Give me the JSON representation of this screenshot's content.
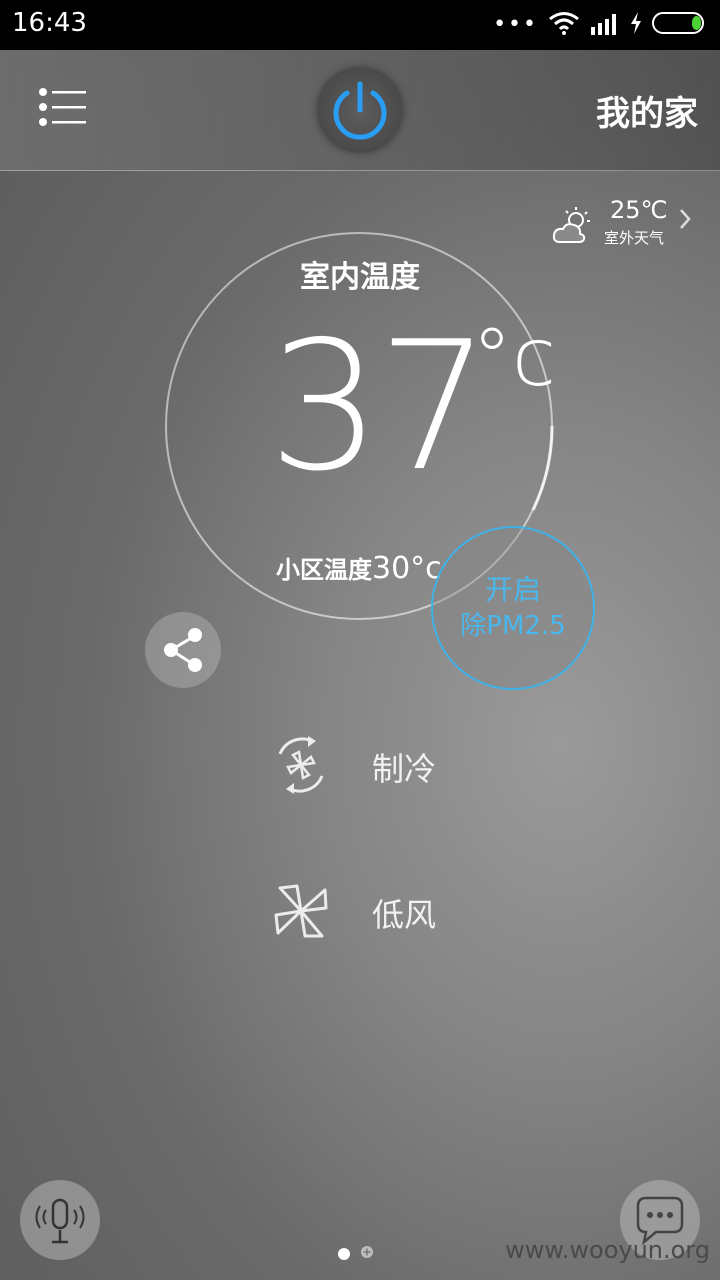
{
  "status_bar": {
    "time": "16:43",
    "dots": "•••",
    "battery_color": "#4cd137"
  },
  "header": {
    "home_title": "我的家",
    "power_color": "#2a9df4"
  },
  "weather": {
    "temp": "25℃",
    "label": "室外天气"
  },
  "dial": {
    "label": "室内温度",
    "temperature": "37",
    "unit": "°c",
    "community_label": "小区温度",
    "community_value": "30°c"
  },
  "pm_button": {
    "line1": "开启",
    "line2": "除PM2.5",
    "color": "#3fb2ea"
  },
  "modes": {
    "mode_label": "制冷",
    "fan_label": "低风"
  },
  "watermark": "www.wooyun.org"
}
